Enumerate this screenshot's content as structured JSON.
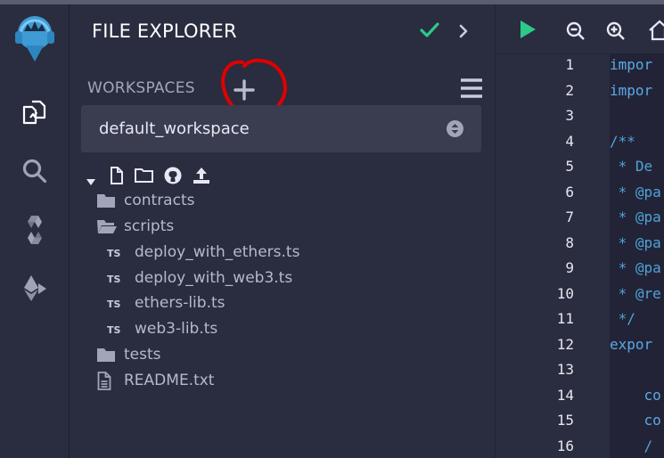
{
  "colors": {
    "accent_green": "#2cc98a",
    "annotation_red": "#e00000",
    "keyword_blue": "#5aa9e6"
  },
  "rail": {
    "items": [
      {
        "name": "remix-logo-icon"
      },
      {
        "name": "file-explorer-icon"
      },
      {
        "name": "search-icon"
      },
      {
        "name": "solidity-compiler-icon"
      },
      {
        "name": "deploy-run-icon"
      }
    ]
  },
  "panel": {
    "title": "FILE EXPLORER",
    "status_icon": "check-icon",
    "collapse_icon": "chevron-right-icon"
  },
  "workspaces": {
    "label": "WORKSPACES",
    "add_icon": "plus-icon",
    "menu_icon": "hamburger-menu-icon",
    "selected": "default_workspace"
  },
  "file_tools": [
    "caret-down-icon",
    "new-file-icon",
    "new-folder-icon",
    "github-icon",
    "upload-icon"
  ],
  "tree": [
    {
      "type": "folder",
      "name": "contracts",
      "open": false
    },
    {
      "type": "folder",
      "name": "scripts",
      "open": true
    },
    {
      "type": "ts",
      "badge": "TS",
      "name": "deploy_with_ethers.ts"
    },
    {
      "type": "ts",
      "badge": "TS",
      "name": "deploy_with_web3.ts"
    },
    {
      "type": "ts",
      "badge": "TS",
      "name": "ethers-lib.ts"
    },
    {
      "type": "ts",
      "badge": "TS",
      "name": "web3-lib.ts"
    },
    {
      "type": "folder",
      "name": "tests",
      "open": false
    },
    {
      "type": "file",
      "name": "README.txt"
    }
  ],
  "editor": {
    "toolbar_icons": [
      "run-icon",
      "zoom-out-icon",
      "zoom-in-icon",
      "home-icon"
    ],
    "line_numbers": [
      "1",
      "2",
      "3",
      "4",
      "5",
      "6",
      "7",
      "8",
      "9",
      "10",
      "11",
      "12",
      "13",
      "14",
      "15",
      "16"
    ],
    "code_lines": [
      "impor",
      "impor",
      "",
      "/**",
      " * De",
      " * @pa",
      " * @pa",
      " * @pa",
      " * @pa",
      " * @re",
      " */",
      "expor",
      "",
      "    co",
      "    co",
      "    /"
    ]
  }
}
